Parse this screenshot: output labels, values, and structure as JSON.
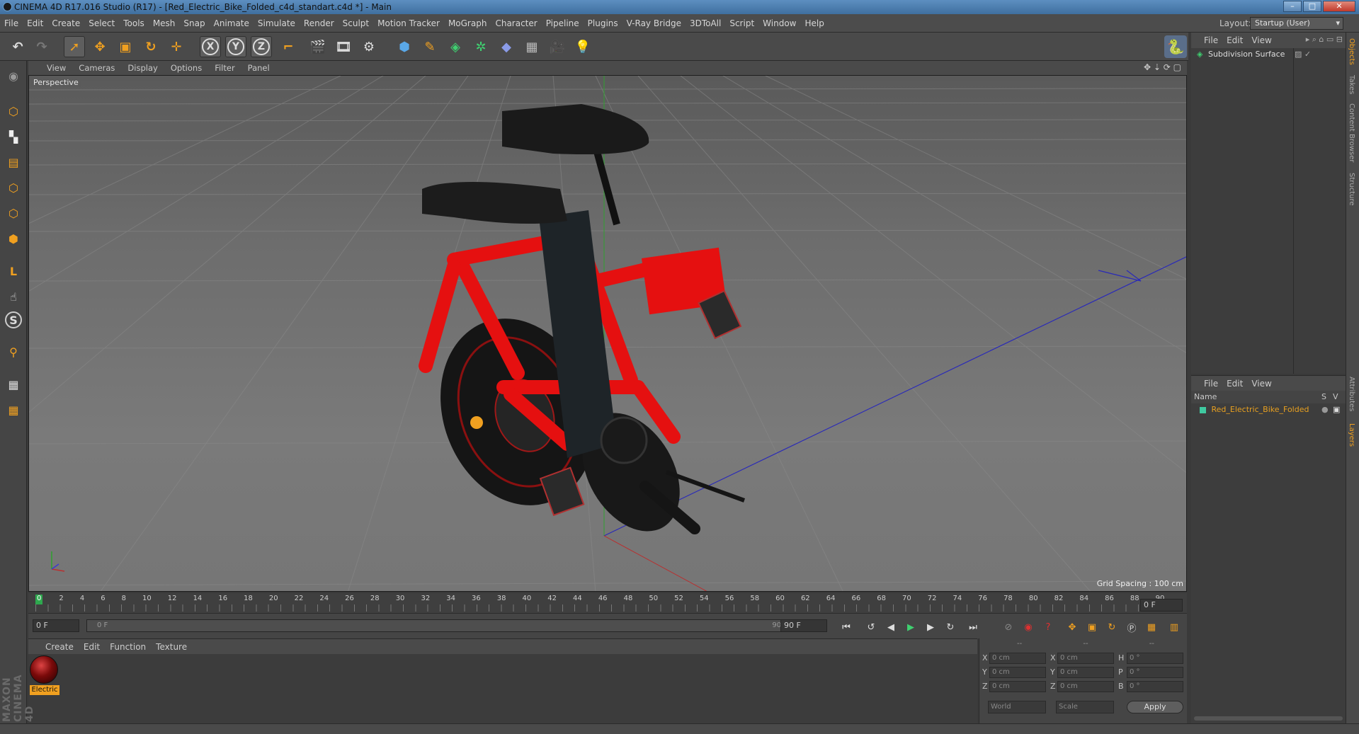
{
  "window": {
    "title": "CINEMA 4D R17.016 Studio (R17) - [Red_Electric_Bike_Folded_c4d_standart.c4d *] - Main",
    "buttons": [
      "–",
      "□",
      "✕"
    ]
  },
  "menu": {
    "items": [
      "File",
      "Edit",
      "Create",
      "Select",
      "Tools",
      "Mesh",
      "Snap",
      "Animate",
      "Simulate",
      "Render",
      "Sculpt",
      "Motion Tracker",
      "MoGraph",
      "Character",
      "Pipeline",
      "Plugins",
      "V-Ray Bridge",
      "3DToAll",
      "Script",
      "Window",
      "Help"
    ],
    "layout_label": "Layout:",
    "layout_value": "Startup (User)"
  },
  "toolbar": {
    "axis_x": "X",
    "axis_y": "Y",
    "axis_z": "Z"
  },
  "viewport": {
    "menu": [
      "View",
      "Cameras",
      "Display",
      "Options",
      "Filter",
      "Panel"
    ],
    "camera_label": "Perspective",
    "grid_spacing": "Grid Spacing : 100 cm"
  },
  "timeline": {
    "ticks": [
      "0",
      "2",
      "4",
      "6",
      "8",
      "10",
      "12",
      "14",
      "16",
      "18",
      "20",
      "22",
      "24",
      "26",
      "28",
      "30",
      "32",
      "34",
      "36",
      "38",
      "40",
      "42",
      "44",
      "46",
      "48",
      "50",
      "52",
      "54",
      "56",
      "58",
      "60",
      "62",
      "64",
      "66",
      "68",
      "70",
      "72",
      "74",
      "76",
      "78",
      "80",
      "82",
      "84",
      "86",
      "88",
      "90"
    ],
    "current_frame": "0 F",
    "start_field": "0 F",
    "range_start": "0 F",
    "range_end": "90 F",
    "end_field": "90 F"
  },
  "material_manager": {
    "menu": [
      "Create",
      "Edit",
      "Function",
      "Texture"
    ],
    "materials": [
      {
        "name": "Electric"
      }
    ]
  },
  "coordinates": {
    "headers": [
      "--",
      "--",
      "--"
    ],
    "rows": [
      {
        "l1": "X",
        "v1": "0 cm",
        "l2": "X",
        "v2": "0 cm",
        "l3": "H",
        "v3": "0 °"
      },
      {
        "l1": "Y",
        "v1": "0 cm",
        "l2": "Y",
        "v2": "0 cm",
        "l3": "P",
        "v3": "0 °"
      },
      {
        "l1": "Z",
        "v1": "0 cm",
        "l2": "Z",
        "v2": "0 cm",
        "l3": "B",
        "v3": "0 °"
      }
    ],
    "space_select": "World",
    "mode_select": "Scale",
    "apply_label": "Apply"
  },
  "object_manager": {
    "menu": [
      "File",
      "Edit",
      "View"
    ],
    "objects": [
      {
        "name": "Subdivision Surface"
      }
    ]
  },
  "layer_manager": {
    "menu": [
      "File",
      "Edit",
      "View"
    ],
    "col_name": "Name",
    "col_s": "S",
    "col_v": "V",
    "layers": [
      {
        "name": "Red_Electric_Bike_Folded",
        "color": "#3fc9a0"
      }
    ]
  },
  "side_tabs": [
    "Objects",
    "Takes",
    "Content Browser",
    "Structure",
    "Attributes",
    "Layers"
  ],
  "brand": "MAXON CINEMA 4D",
  "colors": {
    "accent": "#f0a020",
    "bike_red": "#e01010",
    "layer_text": "#e8a020"
  }
}
